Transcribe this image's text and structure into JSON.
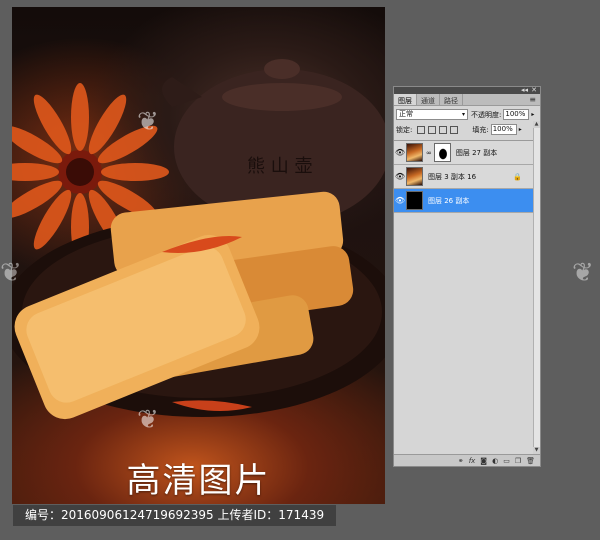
{
  "photo": {
    "title": "高清图片",
    "teapot_text": "熊 山 壶"
  },
  "layers_panel": {
    "tabs": [
      "图层",
      "通道",
      "路径"
    ],
    "blend_mode": "正常",
    "opacity_label": "不透明度:",
    "opacity_value": "100%",
    "lock_label": "锁定:",
    "fill_label": "填充:",
    "fill_value": "100%",
    "layers": [
      {
        "name": "图层 27 副本",
        "thumb": "food",
        "has_mask": true,
        "selected": false
      },
      {
        "name": "图层 3 副本 16",
        "thumb": "food",
        "has_mask": false,
        "selected": false
      },
      {
        "name": "图层 26 副本",
        "thumb": "black",
        "has_mask": false,
        "selected": true
      }
    ],
    "footer_icons": [
      "link-icon",
      "fx-icon",
      "mask-icon",
      "adjustment-icon",
      "group-icon",
      "new-layer-icon",
      "trash-icon"
    ]
  },
  "info_bar": {
    "text": "编号：20160906124719692395 上传者ID：171439"
  },
  "colors": {
    "selection": "#3c8ef0",
    "panel_bg": "#d6d6d6",
    "background": "#5e5e5e"
  }
}
